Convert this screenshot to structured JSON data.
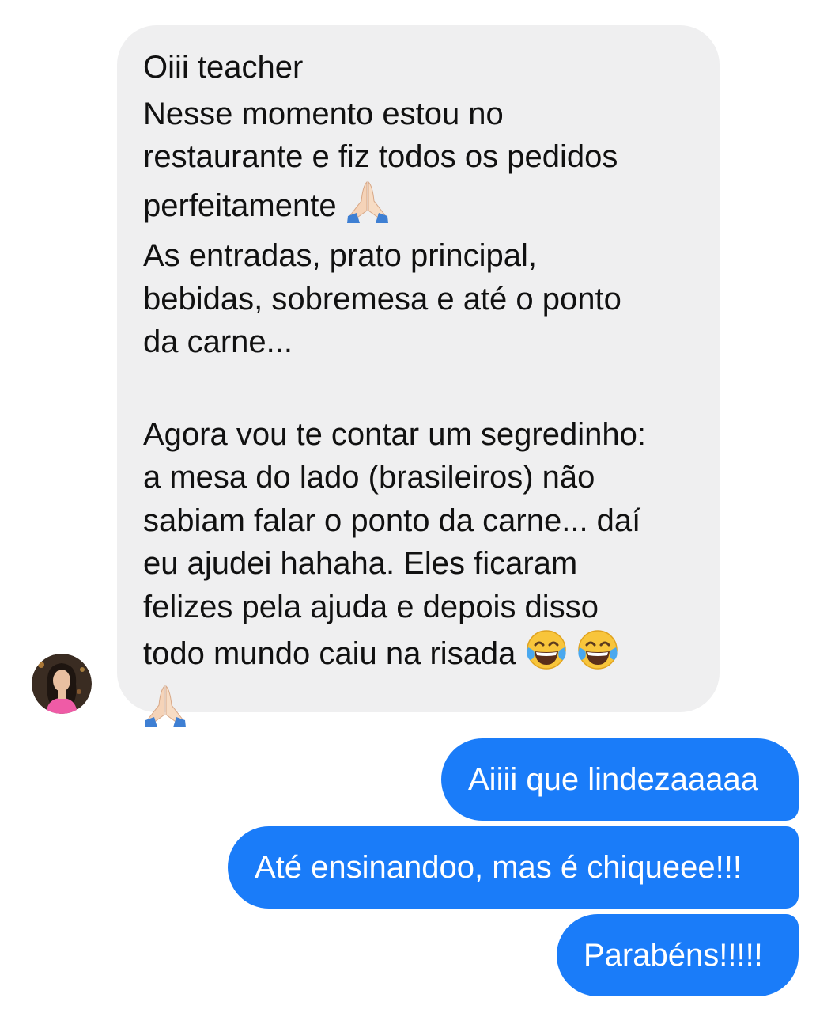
{
  "conversation": {
    "incoming_message": {
      "lines": [
        "Oiii teacher",
        "Nesse momento estou no",
        "restaurante e fiz todos os pedidos",
        "perfeitamente",
        "As entradas, prato principal,",
        "bebidas, sobremesa e até o ponto",
        "da carne...",
        "Agora vou te contar um segredinho:",
        "a mesa do lado (brasileiros) não",
        "sabiam falar o ponto da carne... daí",
        "eu ajudei hahaha. Eles ficaram",
        "felizes pela ajuda e depois disso",
        "todo mundo caiu na risada"
      ],
      "emojis": [
        "folded-hands-emoji",
        "tears-of-joy-emoji",
        "tears-of-joy-emoji",
        "folded-hands-emoji"
      ],
      "bubble_color": "#efeff0"
    },
    "sender_avatar": "avatar-woman-pink-top",
    "outgoing_messages": [
      "Aiiii que lindezaaaaa",
      "Até ensinandoo, mas é chiqueee!!!",
      "Parabéns!!!!!"
    ],
    "outgoing_color": "#1a7cf9"
  }
}
